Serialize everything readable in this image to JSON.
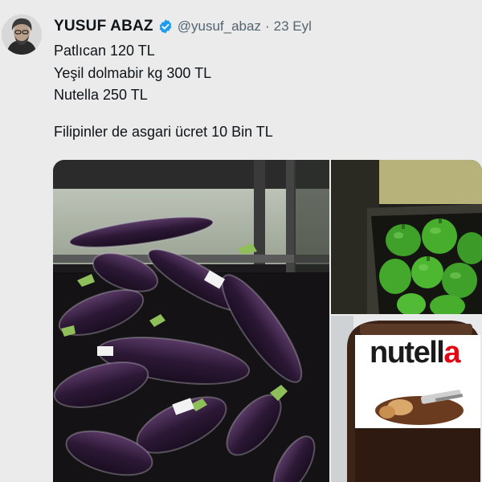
{
  "tweet": {
    "author_name": "YUSUF ABAZ",
    "handle": "@yusuf_abaz",
    "separator": "·",
    "date": "23 Eyl",
    "lines": [
      "Patlıcan 120 TL",
      "Yeşil dolmabir kg 300 TL",
      "Nutella 250 TL"
    ],
    "last_line": "Filipinler de asgari ücret 10 Bin TL"
  },
  "media": {
    "photo_3_brand": {
      "dark": "nutell",
      "accent": "a"
    }
  },
  "colors": {
    "verified": "#1d9bf0",
    "handle_gray": "#536471",
    "nutella_red": "#e30613"
  }
}
